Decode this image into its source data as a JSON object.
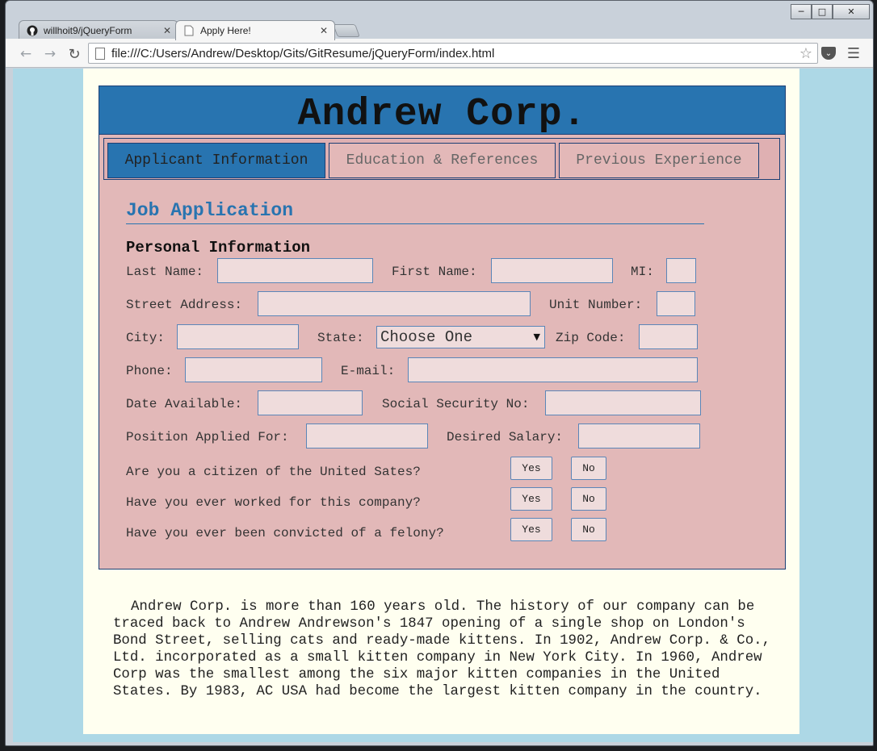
{
  "browser": {
    "tabs": [
      {
        "title": "willhoit9/jQueryForm",
        "icon": "github-icon",
        "active": false
      },
      {
        "title": "Apply Here!",
        "icon": "page-icon",
        "active": true
      }
    ],
    "url": "file:///C:/Users/Andrew/Desktop/Gits/GitResume/jQueryForm/index.html"
  },
  "header": {
    "company": "Andrew Corp."
  },
  "form_tabs": [
    {
      "label": "Applicant Information",
      "active": true
    },
    {
      "label": "Education & References",
      "active": false
    },
    {
      "label": "Previous Experience",
      "active": false
    }
  ],
  "form": {
    "title": "Job Application",
    "section": "Personal Information",
    "labels": {
      "last_name": "Last Name:",
      "first_name": "First Name:",
      "mi": "MI:",
      "street": "Street Address:",
      "unit": "Unit Number:",
      "city": "City:",
      "state": "State:",
      "zip": "Zip Code:",
      "phone": "Phone:",
      "email": "E-mail:",
      "date_available": "Date Available:",
      "ssn": "Social Security No:",
      "position": "Position Applied For:",
      "salary": "Desired Salary:"
    },
    "state_selected": "Choose One",
    "questions": [
      {
        "text": "Are you a citizen of the United Sates?",
        "yes": "Yes",
        "no": "No"
      },
      {
        "text": "Have you ever worked for this company?",
        "yes": "Yes",
        "no": "No"
      },
      {
        "text": "Have you ever been convicted of a felony?",
        "yes": "Yes",
        "no": "No"
      }
    ]
  },
  "about": "Andrew Corp. is more than 160 years old. The history of our company can be traced back to Andrew Andrewson's 1847 opening of a single shop on London's Bond Street, selling cats and ready-made kittens. In 1902, Andrew Corp. & Co., Ltd. incorporated as a small kitten company in New York City. In 1960, Andrew Corp was the smallest among the six major kitten companies in the United States. By 1983, AC USA had become the largest kitten company in the country.",
  "colors": {
    "header_blue": "#2874b0",
    "form_pink": "#e2b8b8",
    "page_bg": "#add8e6",
    "content_bg": "#fffff0"
  }
}
